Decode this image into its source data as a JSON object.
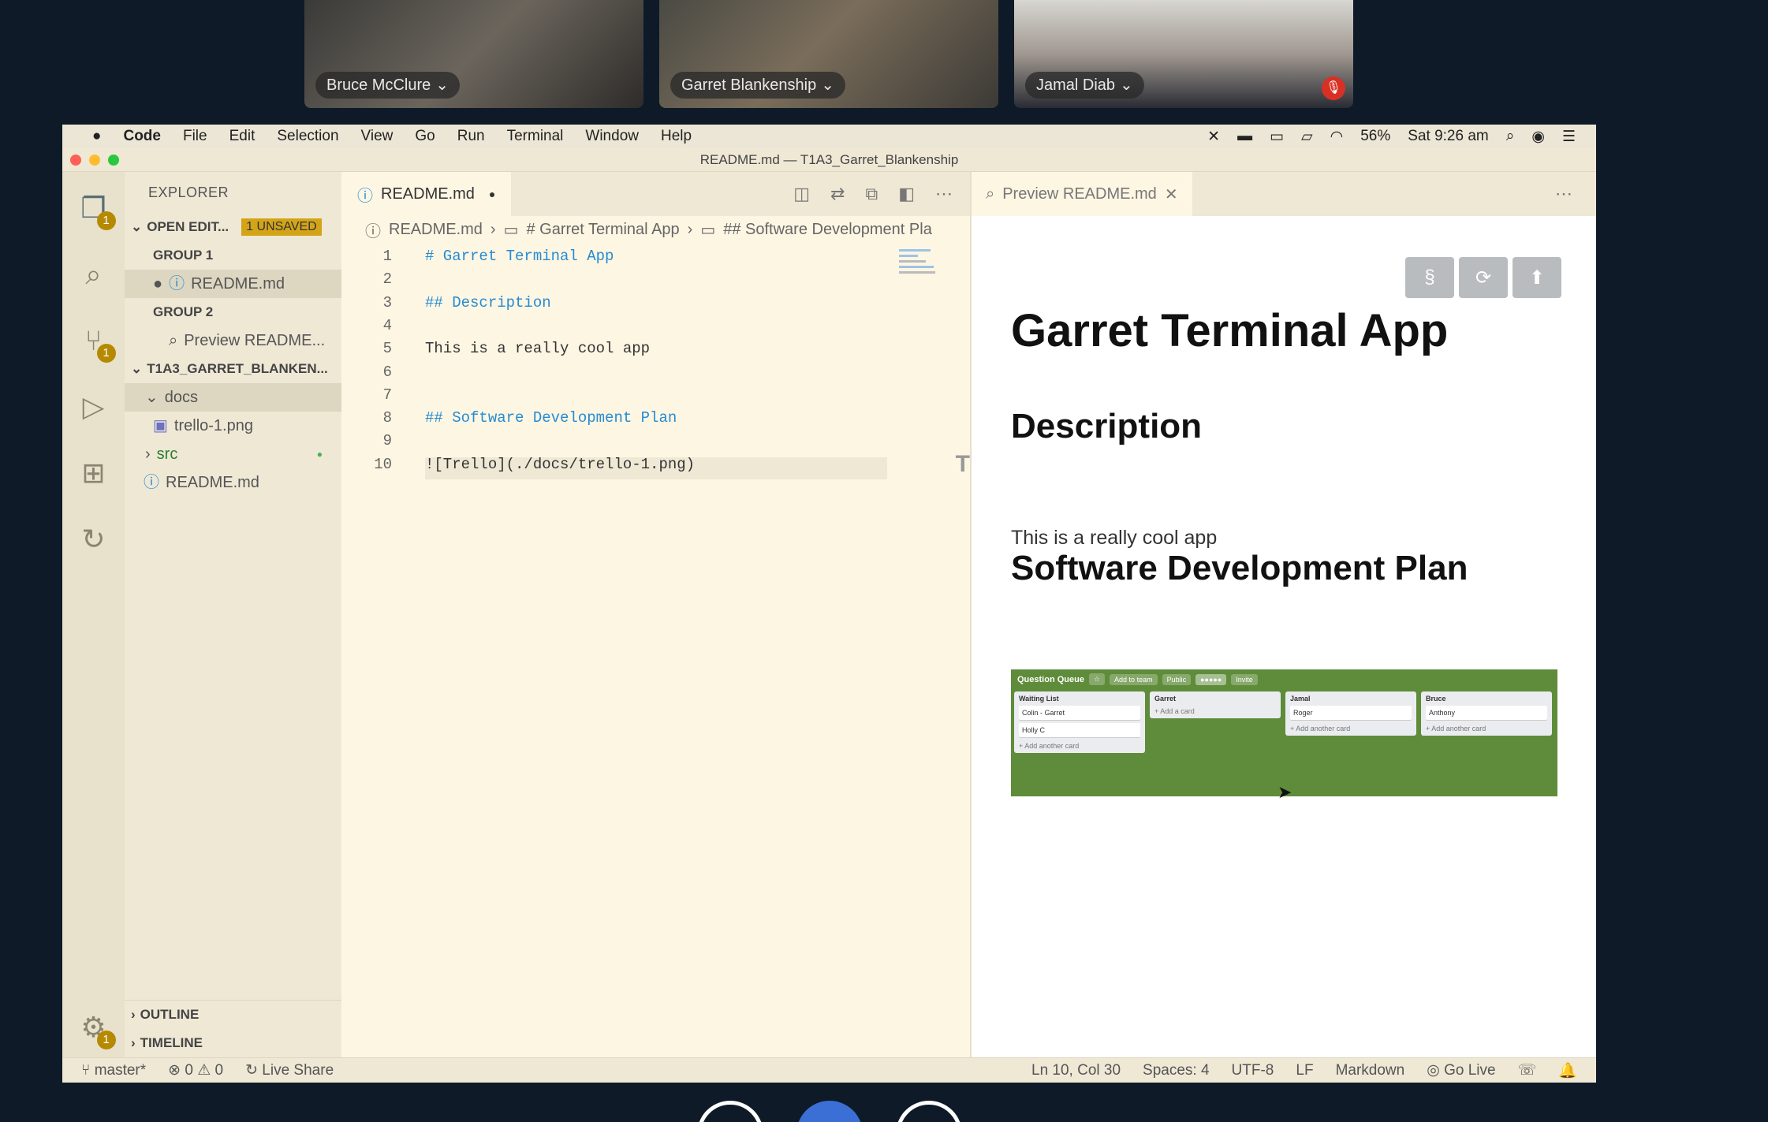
{
  "participants": [
    {
      "name": "Bruce McClure"
    },
    {
      "name": "Garret Blankenship"
    },
    {
      "name": "Jamal Diab"
    }
  ],
  "menubar": {
    "app": "Code",
    "items": [
      "File",
      "Edit",
      "Selection",
      "View",
      "Go",
      "Run",
      "Terminal",
      "Window",
      "Help"
    ],
    "battery": "56%",
    "clock": "Sat 9:26 am"
  },
  "window_title": "README.md — T1A3_Garret_Blankenship",
  "activity": {
    "explorer_badge": "1",
    "scm_badge": "1",
    "settings_badge": "1"
  },
  "sidebar": {
    "title": "EXPLORER",
    "open_editors": "OPEN EDIT...",
    "unsaved": "1 UNSAVED",
    "group1": "GROUP 1",
    "group1_file": "README.md",
    "group2": "GROUP 2",
    "group2_file": "Preview README...",
    "project": "T1A3_GARRET_BLANKEN...",
    "docs": "docs",
    "trello_file": "trello-1.png",
    "src": "src",
    "readme": "README.md",
    "outline": "OUTLINE",
    "timeline": "TIMELINE"
  },
  "editor": {
    "tab": "README.md",
    "breadcrumb": [
      "README.md",
      "# Garret Terminal App",
      "## Software Development Pla"
    ],
    "lines": [
      {
        "n": "1",
        "text": "# Garret Terminal App",
        "h": true
      },
      {
        "n": "2",
        "text": "",
        "h": false
      },
      {
        "n": "3",
        "text": "## Description",
        "h": true
      },
      {
        "n": "4",
        "text": "",
        "h": false
      },
      {
        "n": "5",
        "text": "This is a really cool app",
        "h": false
      },
      {
        "n": "6",
        "text": "",
        "h": false
      },
      {
        "n": "7",
        "text": "",
        "h": false
      },
      {
        "n": "8",
        "text": "## Software Development Plan",
        "h": true
      },
      {
        "n": "9",
        "text": "",
        "h": false
      },
      {
        "n": "10",
        "text": "![Trello](./docs/trello-1.png)",
        "h": false
      }
    ]
  },
  "preview": {
    "tab": "Preview README.md",
    "h1": "Garret Terminal App",
    "h2_desc": "Description",
    "para": "This is a really cool app",
    "h2_plan": "Software Development Plan",
    "trello": {
      "board": "Question Queue",
      "buttons": [
        "Add to team",
        "Public",
        "Invite"
      ],
      "lists": [
        {
          "name": "Waiting List",
          "cards": [
            "Colin - Garret",
            "Holly C"
          ],
          "add": "+ Add another card"
        },
        {
          "name": "Garret",
          "cards": [],
          "add": "+ Add a card"
        },
        {
          "name": "Jamal",
          "cards": [
            "Roger"
          ],
          "add": "+ Add another card"
        },
        {
          "name": "Bruce",
          "cards": [
            "Anthony"
          ],
          "add": "+ Add another card"
        }
      ]
    }
  },
  "status": {
    "branch": "master*",
    "problems": "⊗ 0 ⚠ 0",
    "liveshare": "Live Share",
    "position": "Ln 10, Col 30",
    "spaces": "Spaces: 4",
    "encoding": "UTF-8",
    "eol": "LF",
    "language": "Markdown",
    "golive": "Go Live"
  }
}
